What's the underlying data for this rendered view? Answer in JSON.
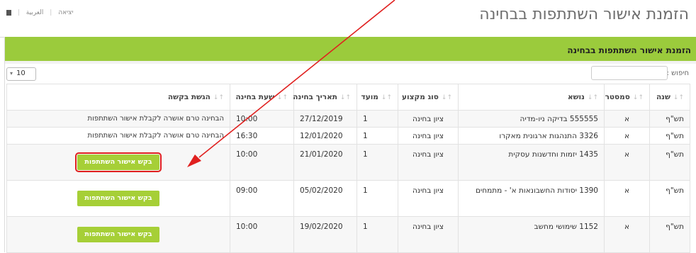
{
  "header": {
    "title": "הזמנת אישור השתתפות בבחינה",
    "links": [
      "יציאה",
      "العربية"
    ]
  },
  "panel": {
    "title": "הזמנת אישור השתתפות בבחינה"
  },
  "search": {
    "label": "חיפוש :",
    "value": ""
  },
  "page_length": {
    "selected": "10"
  },
  "table": {
    "columns": [
      "שנה",
      "סמסטר",
      "נושא",
      "סוג מקצוע",
      "מועד",
      "תאריך בחינה",
      "שעת בחינה",
      "הגשת בקשה"
    ],
    "rows": [
      {
        "year": "תש\"ף",
        "semester": "א",
        "subject": "555555 בדיקה ניו-מדיה",
        "type": "ציון בחינה",
        "moed": "1",
        "date": "27/12/2019",
        "time": "10:00",
        "request": "הבחינה טרם אושרה לקבלת אישור השתתפות"
      },
      {
        "year": "תש\"ף",
        "semester": "א",
        "subject": "3326 התנהגות ארגונית מאקרו",
        "type": "ציון בחינה",
        "moed": "1",
        "date": "12/01/2020",
        "time": "16:30",
        "request": "הבחינה טרם אושרה לקבלת אישור השתתפות"
      },
      {
        "year": "תש\"ף",
        "semester": "א",
        "subject": "1435 יזמות וחדשנות עסקית",
        "type": "ציון בחינה",
        "moed": "1",
        "date": "21/01/2020",
        "time": "10:00",
        "request": "בקש אישור השתתפות"
      },
      {
        "year": "תש\"ף",
        "semester": "א",
        "subject": "1390 יסודות החשבונאות א' - מתמחים",
        "type": "ציון בחינה",
        "moed": "1",
        "date": "05/02/2020",
        "time": "09:00",
        "request": "בקש אישור השתתפות"
      },
      {
        "year": "תש\"ף",
        "semester": "א",
        "subject": "1152 שימושי מחשב",
        "type": "ציון בחינה",
        "moed": "1",
        "date": "19/02/2020",
        "time": "10:00",
        "request": "בקש אישור השתתפות"
      }
    ]
  },
  "colors": {
    "accent_green": "#9bcb3c",
    "button_green": "#a6cf37",
    "annotation_red": "#e0201f"
  },
  "icons": {
    "copy": "copy-icon",
    "sort": "sort-icon",
    "dropdown": "chevron-down-icon",
    "annotation": "arrow-annotation"
  }
}
